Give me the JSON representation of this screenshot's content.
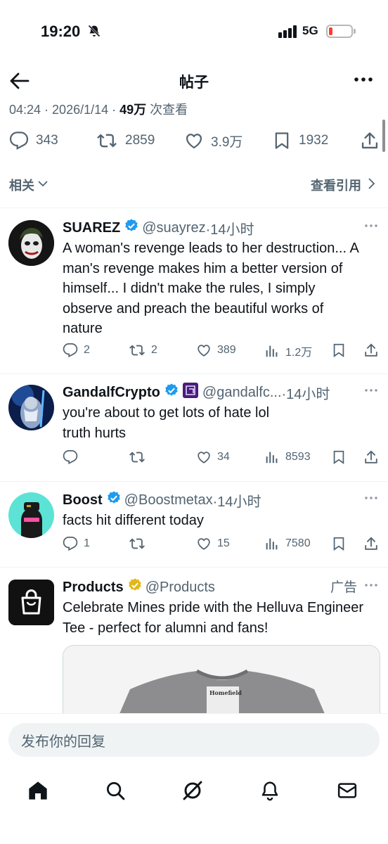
{
  "status_bar": {
    "time": "19:20",
    "network": "5G"
  },
  "header": {
    "title": "帖子"
  },
  "post_meta": {
    "time": "04:24",
    "separator": " · ",
    "date": "2026/1/14",
    "views": "49万",
    "views_label": " 次查看"
  },
  "stats": {
    "replies": "343",
    "reposts": "2859",
    "likes": "3.9万",
    "bookmarks": "1932"
  },
  "filters": {
    "related_label": "相关",
    "view_quotes_label": "查看引用"
  },
  "tweets": [
    {
      "name": "SUAREZ",
      "handle": "@suayrez",
      "time": "·14小时",
      "text": "A woman's revenge leads to her destruction... A man's revenge makes him a better version of himself... I didn't make the rules, I simply observe and preach the beautiful works of nature",
      "replies": "2",
      "reposts": "2",
      "likes": "389",
      "views": "1.2万"
    },
    {
      "name": "GandalfCrypto",
      "handle": "@gandalfc...",
      "time": "·14小时",
      "text": "you're about to get lots of hate lol\ntruth hurts",
      "replies": "",
      "reposts": "",
      "likes": "34",
      "views": "8593"
    },
    {
      "name": "Boost",
      "handle": "@Boostmetax",
      "time": "·14小时",
      "text": "facts hit different today",
      "replies": "1",
      "reposts": "",
      "likes": "15",
      "views": "7580"
    },
    {
      "name": "Products",
      "handle": "@Products",
      "ad_label": "广告",
      "text": "Celebrate Mines pride with the Helluva Engineer Tee - perfect for alumni and fans!",
      "image_tag_text": "Homefield"
    }
  ],
  "reply": {
    "placeholder": "发布你的回复"
  },
  "colors": {
    "verified_blue": "#1d9bf0",
    "verified_gold": "#e2b719",
    "text": "#0f1419",
    "muted": "#536471",
    "battery_low": "#ff3b30"
  },
  "icons": [
    "back-arrow-icon",
    "more-icon",
    "reply-icon",
    "repost-icon",
    "like-icon",
    "bookmark-icon",
    "share-icon",
    "views-icon",
    "home-icon",
    "search-icon",
    "grok-icon",
    "notifications-icon",
    "messages-icon"
  ]
}
